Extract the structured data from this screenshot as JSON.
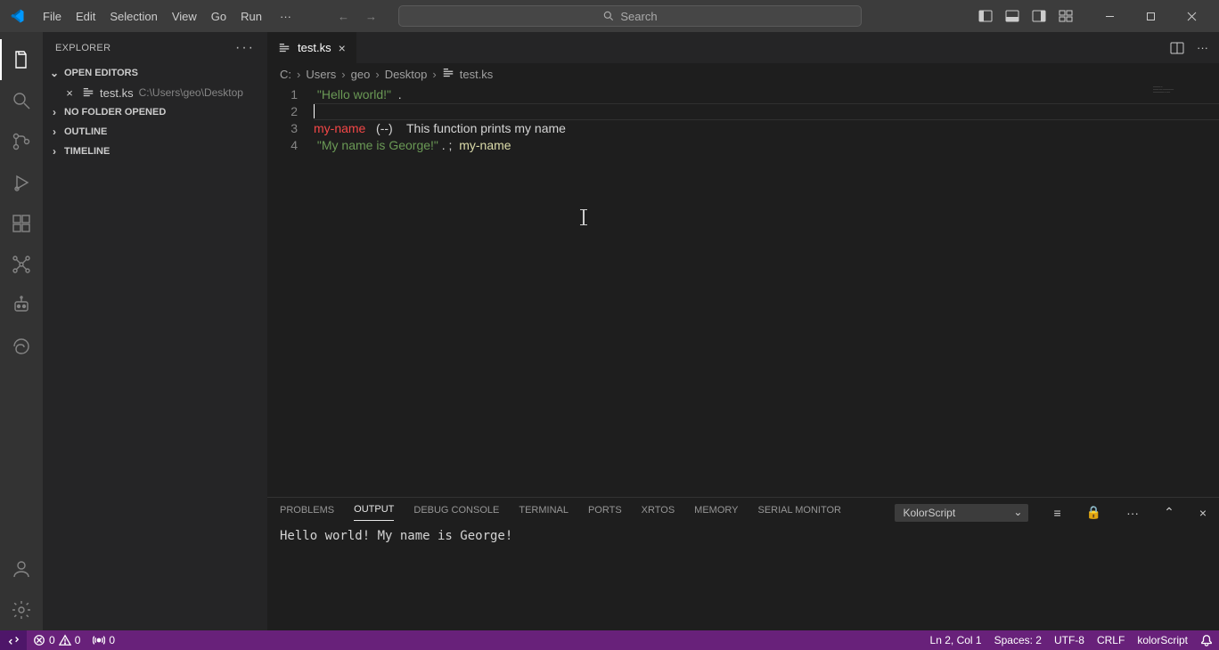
{
  "menu": {
    "items": [
      "File",
      "Edit",
      "Selection",
      "View",
      "Go",
      "Run"
    ]
  },
  "search": {
    "placeholder": "Search"
  },
  "activitybar": {
    "items": [
      {
        "name": "explorer",
        "active": true
      },
      {
        "name": "search",
        "active": false
      },
      {
        "name": "source-control",
        "active": false
      },
      {
        "name": "run-debug",
        "active": false
      },
      {
        "name": "extensions",
        "active": false
      },
      {
        "name": "custom-graph",
        "active": false
      },
      {
        "name": "custom-robot",
        "active": false
      },
      {
        "name": "custom-swirl",
        "active": false
      }
    ]
  },
  "sidebar": {
    "title": "EXPLORER",
    "sections": {
      "openEditors": {
        "label": "OPEN EDITORS",
        "expanded": true,
        "items": [
          {
            "name": "test.ks",
            "path": "C:\\Users\\geo\\Desktop"
          }
        ]
      },
      "noFolder": {
        "label": "NO FOLDER OPENED",
        "expanded": false
      },
      "outline": {
        "label": "OUTLINE",
        "expanded": false
      },
      "timeline": {
        "label": "TIMELINE",
        "expanded": false
      }
    }
  },
  "tabs": {
    "active": {
      "name": "test.ks"
    }
  },
  "breadcrumbs": {
    "parts": [
      "C:",
      "Users",
      "geo",
      "Desktop",
      "test.ks"
    ]
  },
  "code": {
    "active_line": 2,
    "lines": [
      {
        "num": 1,
        "tokens": [
          {
            "t": " ",
            "c": "white"
          },
          {
            "t": "\"Hello world!\"",
            "c": "str"
          },
          {
            "t": "  .",
            "c": "white"
          }
        ]
      },
      {
        "num": 2,
        "tokens": []
      },
      {
        "num": 3,
        "tokens": [
          {
            "t": "my-name",
            "c": "red"
          },
          {
            "t": "   (--)    This function prints my name",
            "c": "comment"
          }
        ]
      },
      {
        "num": 4,
        "tokens": [
          {
            "t": " ",
            "c": "white"
          },
          {
            "t": "\"My name is George!\"",
            "c": "str"
          },
          {
            "t": " . ;  ",
            "c": "white"
          },
          {
            "t": "my-name",
            "c": "yellow"
          }
        ]
      }
    ]
  },
  "panel": {
    "tabs": [
      "PROBLEMS",
      "OUTPUT",
      "DEBUG CONSOLE",
      "TERMINAL",
      "PORTS",
      "XRTOS",
      "MEMORY",
      "SERIAL MONITOR"
    ],
    "active": "OUTPUT",
    "selector": "KolorScript",
    "output": "Hello world! My name is George!"
  },
  "status": {
    "errors": "0",
    "warnings": "0",
    "ports": "0",
    "lncol": "Ln 2, Col 1",
    "spaces": "Spaces: 2",
    "encoding": "UTF-8",
    "eol": "CRLF",
    "lang": "kolorScript"
  }
}
